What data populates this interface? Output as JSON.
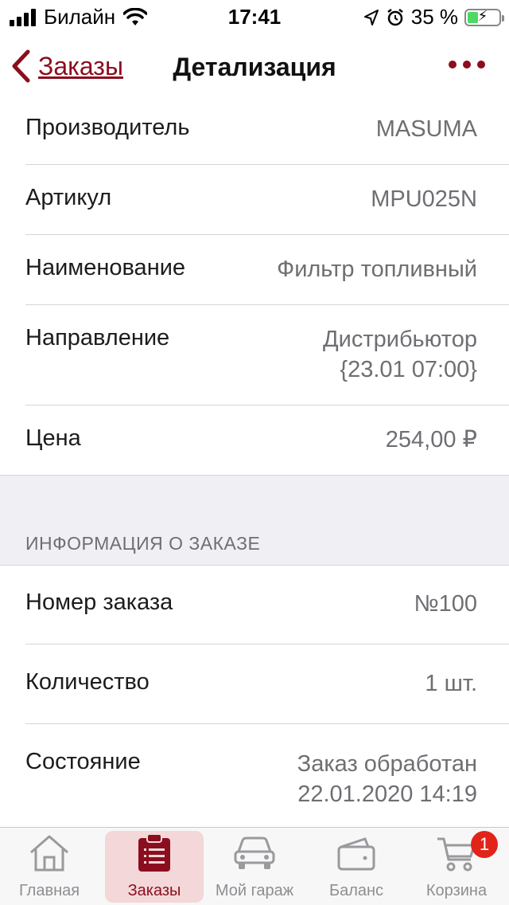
{
  "status_bar": {
    "carrier": "Билайн",
    "time": "17:41",
    "battery_percent": "35 %",
    "battery_level": 0.35,
    "icons": [
      "signal-icon",
      "wifi-icon",
      "location-icon",
      "alarm-icon",
      "battery-icon"
    ]
  },
  "nav": {
    "back_label": "Заказы",
    "title": "Детализация",
    "accent_color": "#8b0e1e"
  },
  "details": [
    {
      "label": "Производитель",
      "value": "MASUMA"
    },
    {
      "label": "Артикул",
      "value": "MPU025N"
    },
    {
      "label": "Наименование",
      "value": "Фильтр топливный"
    },
    {
      "label": "Направление",
      "value_line1": "Дистрибьютор",
      "value_line2": "{23.01 07:00}"
    },
    {
      "label": "Цена",
      "value": "254,00 ₽"
    }
  ],
  "order_section": {
    "header": "ИНФОРМАЦИЯ О ЗАКАЗЕ",
    "rows": [
      {
        "label": "Номер заказа",
        "value": "№100"
      },
      {
        "label": "Количество",
        "value": "1 шт."
      },
      {
        "label": "Состояние",
        "value_line1": "Заказ обработан",
        "value_line2": "22.01.2020 14:19"
      }
    ]
  },
  "tab_bar": {
    "tabs": [
      {
        "label": "Главная",
        "icon": "home-icon"
      },
      {
        "label": "Заказы",
        "icon": "clipboard-icon",
        "active": true
      },
      {
        "label": "Мой гараж",
        "icon": "car-icon"
      },
      {
        "label": "Баланс",
        "icon": "wallet-icon"
      },
      {
        "label": "Корзина",
        "icon": "cart-icon",
        "badge": "1"
      }
    ]
  }
}
